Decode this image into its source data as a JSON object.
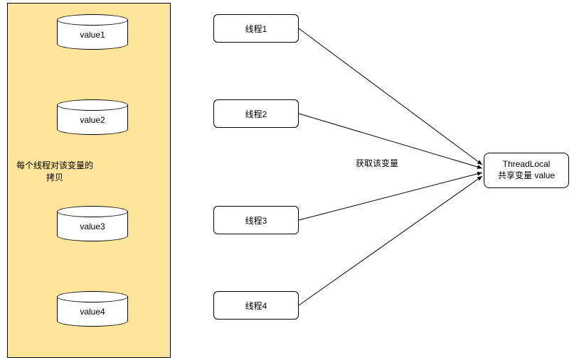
{
  "container": {
    "caption_line1": "每个线程对该变量的",
    "caption_line2": "拷贝"
  },
  "cylinders": [
    {
      "label": "value1"
    },
    {
      "label": "value2"
    },
    {
      "label": "value3"
    },
    {
      "label": "value4"
    }
  ],
  "threads": [
    {
      "label": "线程1"
    },
    {
      "label": "线程2"
    },
    {
      "label": "线程3"
    },
    {
      "label": "线程4"
    }
  ],
  "edge_label": "获取该变量",
  "target": {
    "line1": "ThreadLocal",
    "line2": "共享变量 value"
  }
}
